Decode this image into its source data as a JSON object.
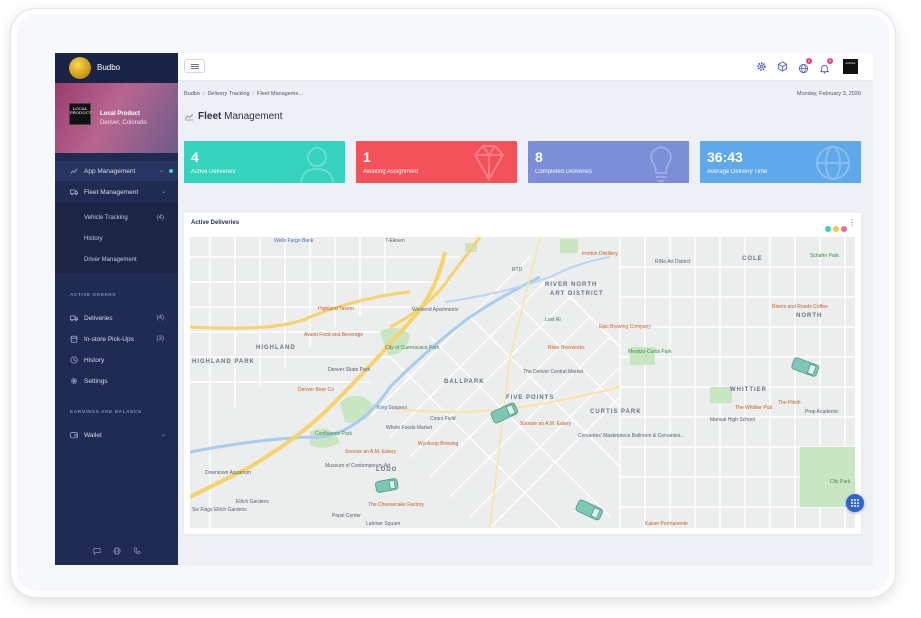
{
  "brand": {
    "name": "Budbo"
  },
  "profile": {
    "name": "Local Product",
    "location": "Denver, Colorado",
    "avatar_text": "LOCAL PRODUCT"
  },
  "sidebar": {
    "main_items": [
      {
        "label": "App Management",
        "icon": "chart-line-icon"
      },
      {
        "label": "Fleet Management",
        "icon": "truck-icon"
      }
    ],
    "fleet_sub": [
      {
        "label": "Vehicle Tracking",
        "count": "(4)"
      },
      {
        "label": "History",
        "count": ""
      },
      {
        "label": "Driver Management",
        "count": ""
      }
    ],
    "active_orders_title": "ACTIVE ORDERS",
    "order_items": [
      {
        "label": "Deliveries",
        "count": "(4)",
        "icon": "truck-icon"
      },
      {
        "label": "In-store Pick-Ups",
        "count": "(3)",
        "icon": "store-icon"
      },
      {
        "label": "History",
        "count": "",
        "icon": "clock-icon"
      },
      {
        "label": "Settings",
        "count": "",
        "icon": "gear-icon"
      }
    ],
    "earnings_title": "EARNINGS AND BALANCE",
    "wallet_label": "Wallet"
  },
  "header": {
    "icons": [
      "gear-icon",
      "cube-icon",
      "globe-icon",
      "bell-icon"
    ],
    "notification_counts": [
      "2",
      "8"
    ],
    "user_thumb_text": "LOCAL"
  },
  "breadcrumb": {
    "items": [
      "Budbo",
      "Delivery Tracking",
      "Fleet Manageme..."
    ]
  },
  "date": "Monday, February 3, 2020",
  "page_title": {
    "bold": "Fleet",
    "rest": " Management"
  },
  "cards": [
    {
      "value": "4",
      "caption": "Active Deliveries",
      "color": "#35d3bd"
    },
    {
      "value": "1",
      "caption": "Awaiting Assignment",
      "color": "#f3525a"
    },
    {
      "value": "8",
      "caption": "Completed Deliveries",
      "color": "#7a8fd8"
    },
    {
      "value": "36:43",
      "caption": "Average Delivery Time",
      "color": "#5fa9ea"
    }
  ],
  "map_panel": {
    "title": "Active Deliveries",
    "dot_colors": [
      "#35d3bd",
      "#f7c844",
      "#f06a8e"
    ]
  },
  "map_labels": {
    "wells_fargo": "Wells Fargo Bank",
    "seven_eleven": "7-Eleven",
    "rino": "RiNo Art District",
    "cole": "COLE",
    "schafer": "Schafer Park",
    "rivers_roads": "Rivers and Roads Coffee",
    "river_north": "RIVER NORTH",
    "art_district": "ART DISTRICT",
    "highland_tavern": "Highland Tavern",
    "westend": "Westend Apartments",
    "epic": "Epic Brewing Company",
    "north": "NORTH",
    "highland": "HIGHLAND",
    "avanti": "Avanti Food and Beverage",
    "commons_park": "City of Cuernavaca Park",
    "rino_beerworks": "River Beerworks",
    "mestizo": "Mestizo-Curtis Park",
    "highland_park": "HIGHLAND PARK",
    "denver_skate": "Denver Skate Park",
    "ballpark": "BALLPARK",
    "denver_central": "The Denver Central Market",
    "whittier": "WHITTIER",
    "denver_beer": "Denver Beer Co",
    "five_points": "FIVE POINTS",
    "king_soopers": "King Soopers",
    "curtis_park": "CURTIS PARK",
    "whittier_pub": "The Whittier Pub",
    "the_plinth": "The Plinth",
    "manual_hs": "Manual High School",
    "whole_foods": "Whole Foods Market",
    "coors_field": "Coors Field",
    "snooze": "Snooze an A.M. Eatery",
    "cervantes": "Cervantes' Masterpiece Ballroom & Cervantes...",
    "confluence": "Confluence Park",
    "snooze2": "Snooze an A.M. Eatery",
    "wynkoop": "Wynkoop Brewing",
    "downtown_aquarium": "Downtown Aquarium",
    "mcamp": "Museum of Contemporary Art",
    "lodo": "LODO",
    "elitch": "Elitch Gardens",
    "cheesecake": "The Cheesecake Factory",
    "pepsi": "Pepsi Center",
    "lower_downtown": "Larimer Square",
    "kaiser": "Kaiser Permanente",
    "city_park": "City Park",
    "prep": "Prep Academic",
    "rtd": "RTD",
    "lost": "Lost Ri",
    "ironton": "Ironton Distillery",
    "six": "Six Flags Elitch Gardens"
  }
}
